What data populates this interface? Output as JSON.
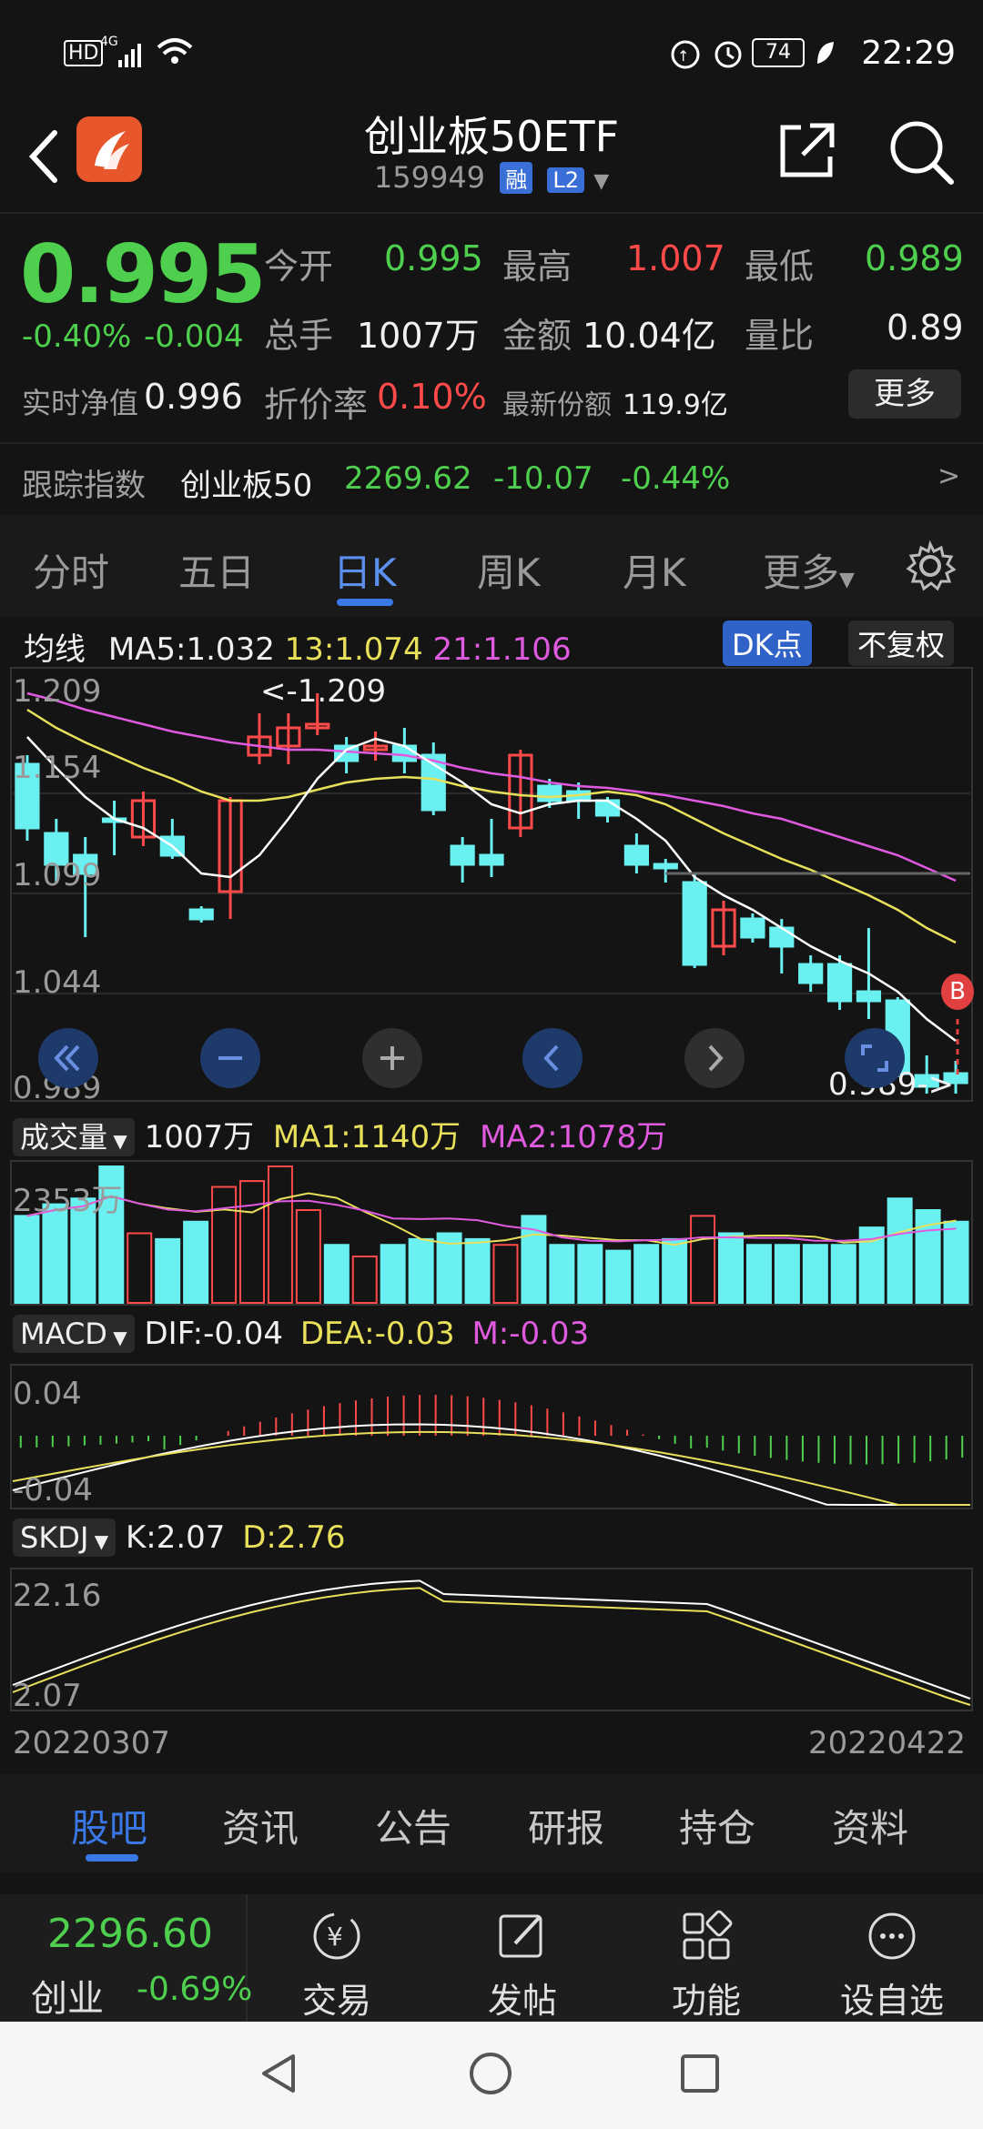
{
  "status_bar": {
    "time": "22:29",
    "battery": "74",
    "network": "4G",
    "hd": "HD"
  },
  "header": {
    "title": "创业板50ETF",
    "code": "159949",
    "tag1": "融",
    "tag2": "L2"
  },
  "quote": {
    "price": "0.995",
    "change_pct": "-0.40%",
    "change": "-0.004",
    "open_label": "今开",
    "open": "0.995",
    "high_label": "最高",
    "high": "1.007",
    "low_label": "最低",
    "low": "0.989",
    "volume_label": "总手",
    "volume": "1007万",
    "amount_label": "金额",
    "amount": "10.04亿",
    "ratio_label": "量比",
    "ratio": "0.89",
    "nav_label": "实时净值",
    "nav": "0.996",
    "discount_label": "折价率",
    "discount": "0.10%",
    "shares_label": "最新份额",
    "shares": "119.9亿",
    "more": "更多"
  },
  "tracking": {
    "label": "跟踪指数",
    "index": "创业板50",
    "value": "2269.62",
    "change": "-10.07",
    "pct": "-0.44%",
    "arrow": ">"
  },
  "tabs": [
    "分时",
    "五日",
    "日K",
    "周K",
    "月K",
    "更多"
  ],
  "active_tab": "日K",
  "kline": {
    "legend": {
      "label": "均线",
      "ma5": "MA5:1.032",
      "ma13": "13:1.074",
      "ma21": "21:1.106"
    },
    "dk_button": "DK点",
    "adjust_button": "不复权",
    "y_labels": [
      "1.209",
      "1.154",
      "1.099",
      "1.044",
      "0.989"
    ],
    "max_label": "<-1.209",
    "min_label": "0.989->",
    "b_marker": "B"
  },
  "volume_panel": {
    "button": "成交量",
    "value": "1007万",
    "ma1": "MA1:1140万",
    "ma2": "MA2:1078万",
    "y_label": "2353万"
  },
  "macd_panel": {
    "button": "MACD",
    "dif": "DIF:-0.04",
    "dea": "DEA:-0.03",
    "m": "M:-0.03",
    "y_top": "0.04",
    "y_bottom": "-0.04"
  },
  "skdj_panel": {
    "button": "SKDJ",
    "k": "K:2.07",
    "d": "D:2.76",
    "y_top": "22.16",
    "y_bottom": "2.07"
  },
  "dates": {
    "start": "20220307",
    "end": "20220422"
  },
  "news_tabs": [
    "股吧",
    "资讯",
    "公告",
    "研报",
    "持仓",
    "资料"
  ],
  "active_news_tab": "股吧",
  "bottom_bar": {
    "index_value": "2296.60",
    "index_name": "创业",
    "index_pct": "-0.69%",
    "items": [
      "交易",
      "发帖",
      "功能",
      "设自选"
    ]
  },
  "colors": {
    "up": "#ff4a4a",
    "down": "#4ed04e",
    "candle_down": "#6af0f0",
    "ma5": "#ffffff",
    "ma13": "#e8e05a",
    "ma21": "#e05ae0",
    "accent": "#3a78e8"
  },
  "chart_data": {
    "type": "candlestick",
    "x": [
      "20220307",
      "20220422"
    ],
    "y_range": [
      0.989,
      1.209
    ],
    "max": 1.209,
    "min": 0.989,
    "candles": [
      {
        "o": 1.17,
        "c": 1.135,
        "h": 1.175,
        "l": 1.128
      },
      {
        "o": 1.132,
        "c": 1.115,
        "h": 1.14,
        "l": 1.105
      },
      {
        "o": 1.12,
        "c": 1.11,
        "h": 1.13,
        "l": 1.075
      },
      {
        "o": 1.14,
        "c": 1.14,
        "h": 1.15,
        "l": 1.12
      },
      {
        "o": 1.13,
        "c": 1.15,
        "h": 1.155,
        "l": 1.125
      },
      {
        "o": 1.13,
        "c": 1.12,
        "h": 1.14,
        "l": 1.118
      },
      {
        "o": 1.09,
        "c": 1.085,
        "h": 1.092,
        "l": 1.083
      },
      {
        "o": 1.1,
        "c": 1.15,
        "h": 1.152,
        "l": 1.085
      },
      {
        "o": 1.175,
        "c": 1.185,
        "h": 1.198,
        "l": 1.17
      },
      {
        "o": 1.18,
        "c": 1.19,
        "h": 1.198,
        "l": 1.17
      },
      {
        "o": 1.19,
        "c": 1.192,
        "h": 1.209,
        "l": 1.186
      },
      {
        "o": 1.18,
        "c": 1.172,
        "h": 1.185,
        "l": 1.165
      },
      {
        "o": 1.178,
        "c": 1.18,
        "h": 1.188,
        "l": 1.172
      },
      {
        "o": 1.18,
        "c": 1.172,
        "h": 1.19,
        "l": 1.165
      },
      {
        "o": 1.175,
        "c": 1.145,
        "h": 1.182,
        "l": 1.142
      },
      {
        "o": 1.125,
        "c": 1.115,
        "h": 1.13,
        "l": 1.105
      },
      {
        "o": 1.12,
        "c": 1.115,
        "h": 1.14,
        "l": 1.108
      },
      {
        "o": 1.135,
        "c": 1.175,
        "h": 1.178,
        "l": 1.13
      },
      {
        "o": 1.158,
        "c": 1.15,
        "h": 1.162,
        "l": 1.146
      },
      {
        "o": 1.155,
        "c": 1.15,
        "h": 1.16,
        "l": 1.14
      },
      {
        "o": 1.15,
        "c": 1.142,
        "h": 1.152,
        "l": 1.138
      },
      {
        "o": 1.125,
        "c": 1.115,
        "h": 1.132,
        "l": 1.11
      },
      {
        "o": 1.115,
        "c": 1.113,
        "h": 1.118,
        "l": 1.105
      },
      {
        "o": 1.105,
        "c": 1.06,
        "h": 1.11,
        "l": 1.058
      },
      {
        "o": 1.07,
        "c": 1.09,
        "h": 1.095,
        "l": 1.065
      },
      {
        "o": 1.085,
        "c": 1.075,
        "h": 1.088,
        "l": 1.072
      },
      {
        "o": 1.08,
        "c": 1.07,
        "h": 1.085,
        "l": 1.055
      },
      {
        "o": 1.06,
        "c": 1.05,
        "h": 1.065,
        "l": 1.045
      },
      {
        "o": 1.06,
        "c": 1.04,
        "h": 1.065,
        "l": 1.035
      },
      {
        "o": 1.045,
        "c": 1.04,
        "h": 1.08,
        "l": 1.03
      },
      {
        "o": 1.04,
        "c": 1.0,
        "h": 1.042,
        "l": 0.998
      },
      {
        "o": 0.999,
        "c": 0.993,
        "h": 1.01,
        "l": 0.989
      },
      {
        "o": 1.0,
        "c": 0.995,
        "h": 1.007,
        "l": 0.989
      }
    ],
    "ma5": [
      1.185,
      1.168,
      1.152,
      1.14,
      1.135,
      1.125,
      1.11,
      1.108,
      1.12,
      1.14,
      1.162,
      1.178,
      1.184,
      1.18,
      1.17,
      1.16,
      1.148,
      1.143,
      1.148,
      1.15,
      1.15,
      1.14,
      1.128,
      1.108,
      1.098,
      1.09,
      1.08,
      1.07,
      1.062,
      1.055,
      1.045,
      1.03,
      1.018
    ],
    "ma13": [
      1.2,
      1.19,
      1.182,
      1.175,
      1.168,
      1.162,
      1.155,
      1.15,
      1.15,
      1.152,
      1.156,
      1.16,
      1.162,
      1.163,
      1.162,
      1.158,
      1.155,
      1.153,
      1.152,
      1.153,
      1.155,
      1.153,
      1.148,
      1.14,
      1.132,
      1.125,
      1.118,
      1.112,
      1.105,
      1.098,
      1.09,
      1.08,
      1.072
    ],
    "ma21": [
      1.209,
      1.205,
      1.2,
      1.196,
      1.192,
      1.188,
      1.185,
      1.182,
      1.18,
      1.178,
      1.178,
      1.177,
      1.176,
      1.175,
      1.172,
      1.168,
      1.165,
      1.163,
      1.16,
      1.158,
      1.157,
      1.155,
      1.153,
      1.15,
      1.147,
      1.143,
      1.14,
      1.135,
      1.13,
      1.125,
      1.12,
      1.113,
      1.106
    ],
    "volume": [
      1500,
      1700,
      1800,
      2353,
      1200,
      1100,
      1400,
      2000,
      2100,
      2353,
      1600,
      1000,
      800,
      1000,
      1100,
      1200,
      1100,
      1000,
      1500,
      1000,
      1000,
      900,
      1000,
      1100,
      1500,
      1200,
      1000,
      1000,
      1000,
      1000,
      1300,
      1800,
      1600,
      1400
    ]
  }
}
